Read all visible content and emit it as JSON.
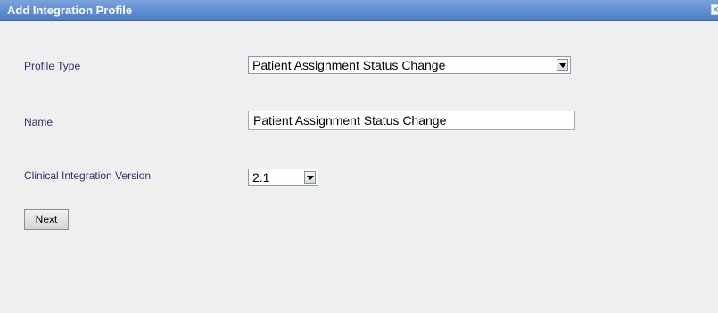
{
  "dialog": {
    "title": "Add Integration Profile",
    "close_icon": "close-icon"
  },
  "form": {
    "profile_type": {
      "label": "Profile Type",
      "value": "Patient Assignment Status Change"
    },
    "name": {
      "label": "Name",
      "value": "Patient Assignment Status Change"
    },
    "version": {
      "label": "Clinical Integration Version",
      "value": "2.1"
    }
  },
  "actions": {
    "next_label": "Next"
  },
  "colors": {
    "titlebar": "#4f7fc9",
    "background": "#efefef",
    "label_text": "#3d2a6e"
  }
}
